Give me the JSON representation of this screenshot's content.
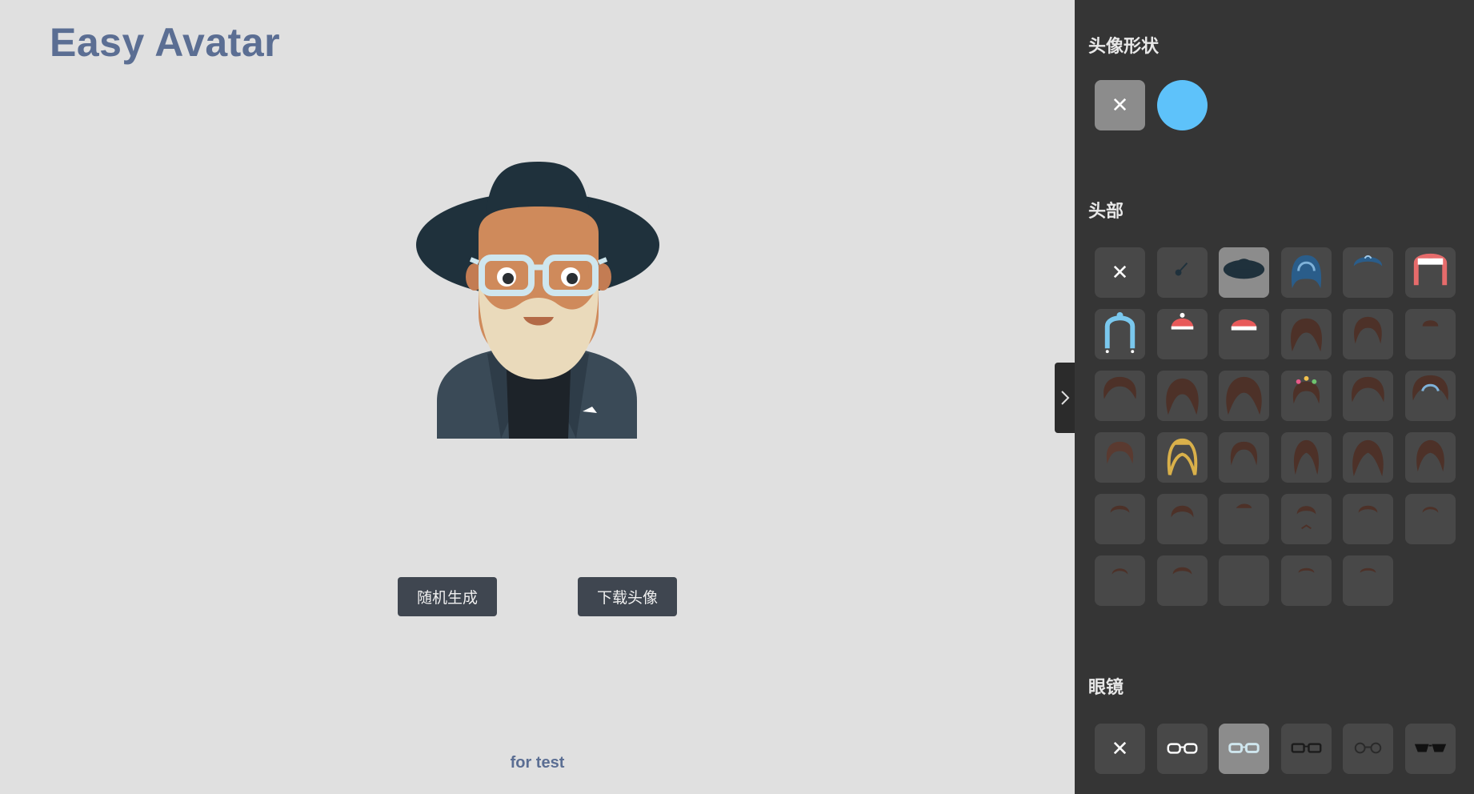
{
  "app": {
    "title": "Easy Avatar",
    "footer": "for test"
  },
  "actions": {
    "random_label": "随机生成",
    "download_label": "下载头像"
  },
  "panel": {
    "shape_title": "头像形状",
    "head_title": "头部",
    "glasses_title": "眼镜",
    "shape_options": [
      "none",
      "circle"
    ],
    "selected_shape": "none",
    "head_selected_index": 2,
    "glasses_selected_index": 2,
    "head_count": 35,
    "glasses_count": 6
  },
  "icons": {
    "close": "close-icon",
    "toggle": "chevron-right-icon"
  },
  "colors": {
    "title": "#5b6e93",
    "sidebar_bg": "#353535",
    "tile_bg": "#484848",
    "tile_selected": "#8c8c8c",
    "shape_circle": "#5ec2fa",
    "button_bg": "#3f4650"
  }
}
